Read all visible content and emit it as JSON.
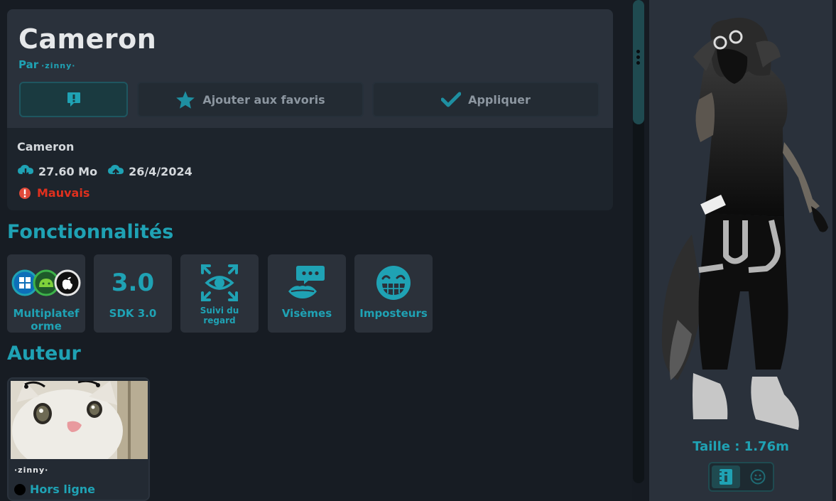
{
  "avatar": {
    "title": "Cameron",
    "by_prefix": "Par",
    "author": "·zinny·",
    "name": "Cameron",
    "file_size": "27.60 Mo",
    "date": "26/4/2024",
    "performance": "Mauvais"
  },
  "actions": {
    "favorite_label": "Ajouter aux favoris",
    "apply_label": "Appliquer"
  },
  "sections": {
    "features_title": "Fonctionnalités",
    "author_title": "Auteur"
  },
  "features": [
    {
      "label": "Multiplateforme",
      "icon": "multiplatform-icon"
    },
    {
      "label": "SDK 3.0",
      "icon": "sdk3-icon",
      "badge": "3.0"
    },
    {
      "label": "Suivi du regard",
      "icon": "eye-tracking-icon"
    },
    {
      "label": "Visèmes",
      "icon": "visemes-icon"
    },
    {
      "label": "Imposteurs",
      "icon": "impostor-icon"
    }
  ],
  "author_card": {
    "name": "·zinny·",
    "status": "Hors ligne"
  },
  "preview": {
    "size_label": "Taille : 1.76m"
  },
  "colors": {
    "accent": "#1fa2b4",
    "danger": "#e0301e",
    "panel": "#2a313b",
    "background": "#171c23"
  }
}
